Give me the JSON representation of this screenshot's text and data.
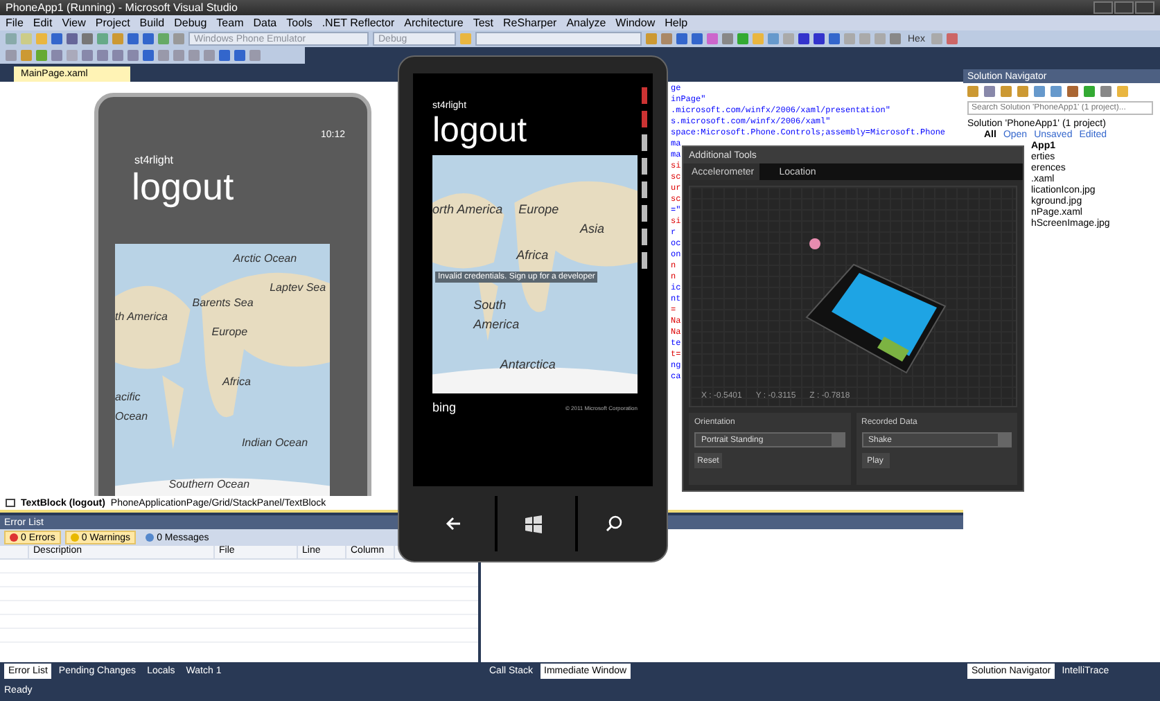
{
  "window": {
    "title": "PhoneApp1 (Running) - Microsoft Visual Studio"
  },
  "menu": [
    "File",
    "Edit",
    "View",
    "Project",
    "Build",
    "Debug",
    "Team",
    "Data",
    "Tools",
    ".NET Reflector",
    "Architecture",
    "Test",
    "ReSharper",
    "Analyze",
    "Window",
    "Help"
  ],
  "toolbar": {
    "target": "Windows Phone Emulator",
    "configuration": "Debug",
    "hex_button": "Hex"
  },
  "document_tab": {
    "label": "MainPage.xaml",
    "selected": true
  },
  "designer": {
    "time": "10:12",
    "app_title": "st4rlight",
    "page_title": "logout",
    "map_labels": [
      "Arctic Ocean",
      "Barents Sea",
      "Laptev Sea",
      "th America",
      "Europe",
      "Africa",
      "acific",
      "Ocean",
      "Indian Ocean",
      "Southern Ocean"
    ]
  },
  "code_lines": [
    {
      "text": "ge",
      "kind": "markup"
    },
    {
      "text": "inPage\"",
      "kind": "markup"
    },
    {
      "text": ".microsoft.com/winfx/2006/xaml/presentation\"",
      "kind": "markup"
    },
    {
      "text": "s.microsoft.com/winfx/2006/xaml\"",
      "kind": "markup"
    },
    {
      "text": "space:Microsoft.Phone.Controls;assembly=Microsoft.Phone",
      "kind": "markup"
    },
    {
      "text": "ma",
      "kind": "markup"
    },
    {
      "text": "ma",
      "kind": "markup"
    },
    {
      "text": "si",
      "kind": "attribute"
    },
    {
      "text": "sc",
      "kind": "attribute"
    },
    {
      "text": "ur",
      "kind": "attribute"
    },
    {
      "text": "sc",
      "kind": "attribute"
    },
    {
      "text": "=\"",
      "kind": "markup"
    },
    {
      "text": "si",
      "kind": "attribute"
    },
    {
      "text": "r",
      "kind": "markup"
    },
    {
      "text": "oc",
      "kind": "markup"
    },
    {
      "text": "on",
      "kind": "markup"
    },
    {
      "text": "n",
      "kind": "attribute"
    },
    {
      "text": "n",
      "kind": "attribute"
    },
    {
      "text": "ic",
      "kind": "markup"
    },
    {
      "text": "nt",
      "kind": "markup"
    },
    {
      "text": "=",
      "kind": "attribute"
    },
    {
      "text": "Na",
      "kind": "attribute"
    },
    {
      "text": "Na",
      "kind": "attribute"
    },
    {
      "text": "te",
      "kind": "markup"
    },
    {
      "text": "t=",
      "kind": "attribute"
    },
    {
      "text": "ng",
      "kind": "markup"
    },
    {
      "text": "ca",
      "kind": "markup"
    }
  ],
  "breadcrumb": {
    "element": "TextBlock (logout)",
    "path": "PhoneApplicationPage/Grid/StackPanel/TextBlock"
  },
  "error_list": {
    "title": "Error List",
    "filters": [
      {
        "label": "0 Errors",
        "kind": "error",
        "selected": true
      },
      {
        "label": "0 Warnings",
        "kind": "warning",
        "selected": true
      },
      {
        "label": "0 Messages",
        "kind": "info",
        "selected": false
      }
    ],
    "columns": [
      "Description",
      "File",
      "Line",
      "Column"
    ]
  },
  "bottom_left_tabs": [
    {
      "label": "Error List",
      "selected": true
    },
    {
      "label": "Pending Changes",
      "selected": false
    },
    {
      "label": "Locals",
      "selected": false
    },
    {
      "label": "Watch 1",
      "selected": false
    }
  ],
  "bottom_middle_tabs": [
    {
      "label": "Call Stack",
      "selected": false
    },
    {
      "label": "Immediate Window",
      "selected": true
    }
  ],
  "solution_navigator": {
    "title": "Solution Navigator",
    "search_placeholder": "Search Solution 'PhoneApp1' (1 project)...",
    "solution": "Solution 'PhoneApp1' (1 project)",
    "filters": [
      {
        "label": "All",
        "selected": true
      },
      {
        "label": "Open",
        "selected": false
      },
      {
        "label": "Unsaved",
        "selected": false
      },
      {
        "label": "Edited",
        "selected": false
      }
    ],
    "items": [
      "App1",
      "erties",
      "erences",
      ".xaml",
      "licationIcon.jpg",
      "kground.jpg",
      "nPage.xaml",
      "hScreenImage.jpg"
    ]
  },
  "right_tabs": [
    {
      "label": "Solution Navigator",
      "selected": true
    },
    {
      "label": "IntelliTrace",
      "selected": false
    }
  ],
  "status_bar": "Ready",
  "emulator": {
    "app_title": "st4rlight",
    "page_title": "logout",
    "banner": "Invalid credentials. Sign up for a developer",
    "map_labels": [
      "orth America",
      "Europe",
      "Asia",
      "Africa",
      "South",
      "America",
      "Antarctica"
    ],
    "logo": "bing",
    "copyright": "© 2011 Microsoft Corporation"
  },
  "additional_tools": {
    "title": "Additional Tools",
    "tabs": [
      {
        "label": "Accelerometer",
        "selected": true
      },
      {
        "label": "Location",
        "selected": false
      }
    ],
    "readings": [
      "X : -0.5401",
      "Y : -0.3115",
      "Z : -0.7818"
    ],
    "orientation": {
      "title": "Orientation",
      "value": "Portrait Standing",
      "button": "Reset"
    },
    "recorded": {
      "title": "Recorded Data",
      "value": "Shake",
      "button": "Play"
    }
  }
}
